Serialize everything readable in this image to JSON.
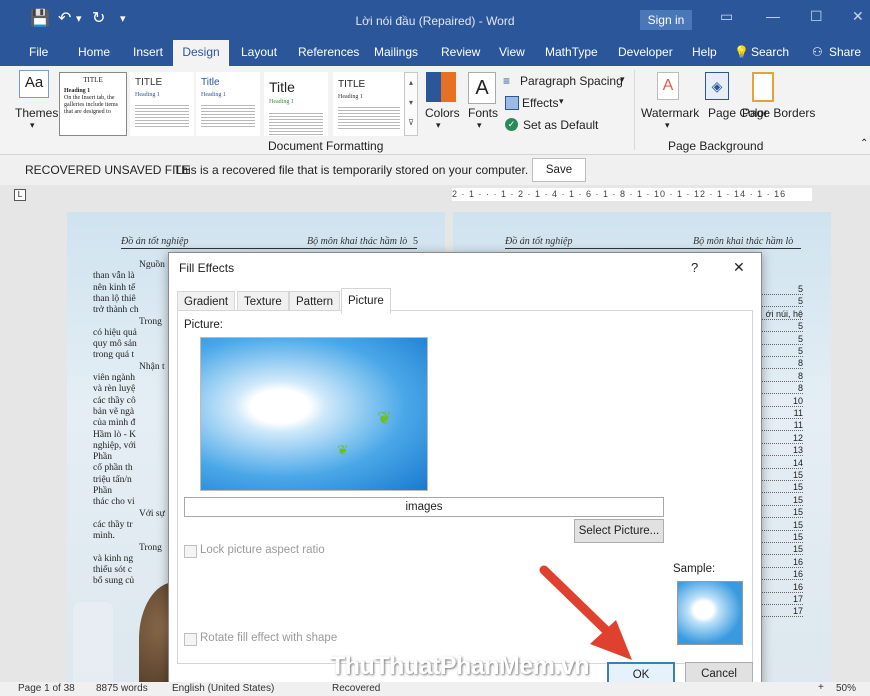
{
  "titlebar": {
    "document_title": "Lời nói đầu (Repaired)  -  Word",
    "signin": "Sign in"
  },
  "tabs": [
    "File",
    "Home",
    "Insert",
    "Design",
    "Layout",
    "References",
    "Mailings",
    "Review",
    "View",
    "MathType",
    "Developer",
    "Help",
    "Search",
    "Share"
  ],
  "ribbon": {
    "themes_label": "Themes",
    "style_titles": [
      "TITLE",
      "Title",
      "Title",
      "TITLE"
    ],
    "style_heading": "Heading 1",
    "style_body": "On the Insert tab, the galleries include items that are designed to",
    "colors_label": "Colors",
    "fonts_label": "Fonts",
    "paragraph_spacing": "Paragraph Spacing",
    "effects": "Effects",
    "set_default": "Set as Default",
    "group_document_formatting": "Document Formatting",
    "watermark": "Watermark",
    "page_color": "Page Color",
    "page_borders": "Page Borders",
    "group_page_background": "Page Background"
  },
  "recovered": {
    "label": "RECOVERED UNSAVED FILE",
    "message": "This is a recovered file that is temporarily stored on your computer.",
    "save": "Save"
  },
  "ruler": "2 · 1 · · · 1 · 2 · 1 · 4 · 1 · 6 · 1 · 8 · 1 · 10 · 1 · 12 · 1 · 14 · 1 · 16",
  "page_left": {
    "header_left": "Đồ án tốt nghiệp",
    "header_right": "Bộ môn khai thác hầm lò",
    "page_no": "5",
    "lines": [
      "Nguồn",
      "than vẫn là",
      "nên kinh tế",
      "than lộ thiê",
      "trở thành ch",
      "Trong",
      "có hiệu quả",
      "quy mô sản",
      "trong quá t",
      "Nhận t",
      "viên ngành",
      "và rèn luyệ",
      "các thầy cô",
      "bản vẽ ngà",
      "của mình đ",
      "Hầm lò - K",
      "nghiệp, với",
      "Phần",
      "cổ phần th",
      "triệu tấn/n",
      "Phần",
      "thác cho vi",
      "Với sự",
      "các thầy tr",
      "mình.",
      "Trong",
      "và kinh ng",
      "thiếu sót c",
      "bổ sung củ"
    ]
  },
  "page_right": {
    "header_left": "Đồ án tốt nghiệp",
    "header_right": "Bộ môn khai thác hầm lò",
    "toc": [
      "5",
      "5",
      "ới núi, hệ",
      "5",
      "5",
      "5",
      "8",
      "8",
      "8",
      "10",
      "11",
      "11",
      "12",
      "13",
      "14",
      "15",
      "15",
      "15",
      "15",
      "15",
      "15",
      "15",
      "16",
      "16",
      "16",
      "17",
      "17"
    ]
  },
  "dialog": {
    "title": "Fill Effects",
    "help": "?",
    "close": "✕",
    "tabs": [
      "Gradient",
      "Texture",
      "Pattern",
      "Picture"
    ],
    "picture_label": "Picture:",
    "picture_name": "images",
    "select_picture": "Select Picture...",
    "lock_aspect": "Lock picture aspect ratio",
    "rotate": "Rotate fill effect with shape",
    "sample": "Sample:",
    "ok": "OK",
    "cancel": "Cancel"
  },
  "status": {
    "page": "Page 1 of 38",
    "words": "8875 words",
    "language": "English (United States)",
    "recovered": "Recovered",
    "zoom": "50%"
  },
  "watermark": "ThuThuatPhanMem.vn",
  "colors": {
    "word_blue": "#2b579a",
    "arrow_red": "#e0412f"
  }
}
